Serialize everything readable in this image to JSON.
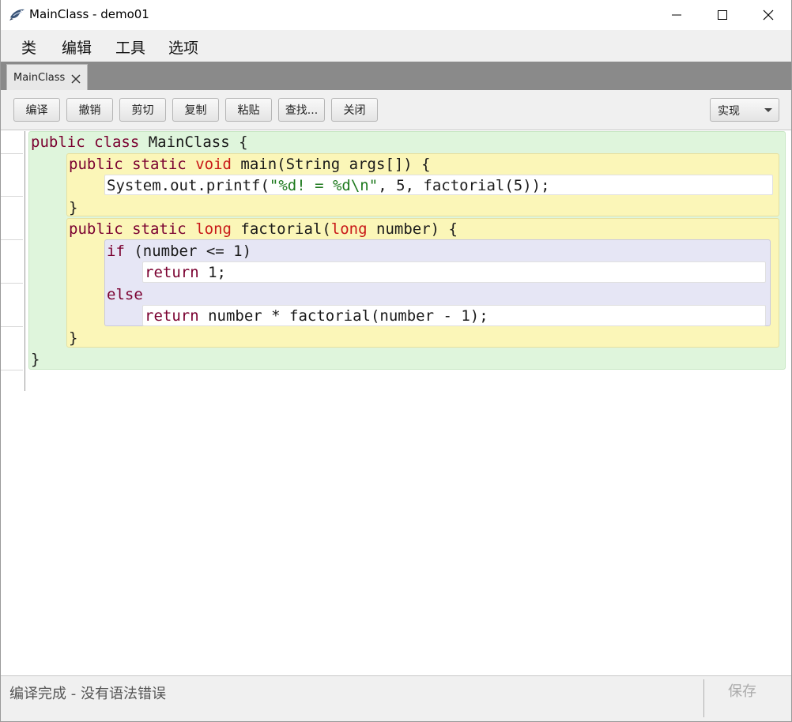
{
  "window": {
    "title": "MainClass - demo01",
    "icon": "app-bird-icon"
  },
  "menu": [
    "类",
    "编辑",
    "工具",
    "选项"
  ],
  "tabs": [
    {
      "label": "MainClass",
      "close_icon": "close-icon"
    }
  ],
  "toolbar": {
    "buttons": [
      "编译",
      "撤销",
      "剪切",
      "复制",
      "粘贴",
      "查找...",
      "关闭"
    ],
    "view_select": "实现"
  },
  "editor": {
    "lines": [
      "public class MainClass {",
      "public static void main(String args[]) {",
      "System.out.printf(\"%d! = %d\\n\", 5, factorial(5));",
      "}",
      "public static long factorial(long number) {",
      "if (number <= 1)",
      "return 1;",
      "else",
      "return number * factorial(number - 1);",
      "}",
      "}"
    ],
    "colors": {
      "class_block": "#dff5dc",
      "method_block": "#fbf6b8",
      "if_block": "#e6e6f5",
      "statement": "#ffffff",
      "keyword": "#7a0030",
      "type_keyword": "#c81818",
      "string": "#1f7a1f"
    }
  },
  "status": {
    "message": "编译完成 - 没有语法错误",
    "save_label": "保存"
  }
}
